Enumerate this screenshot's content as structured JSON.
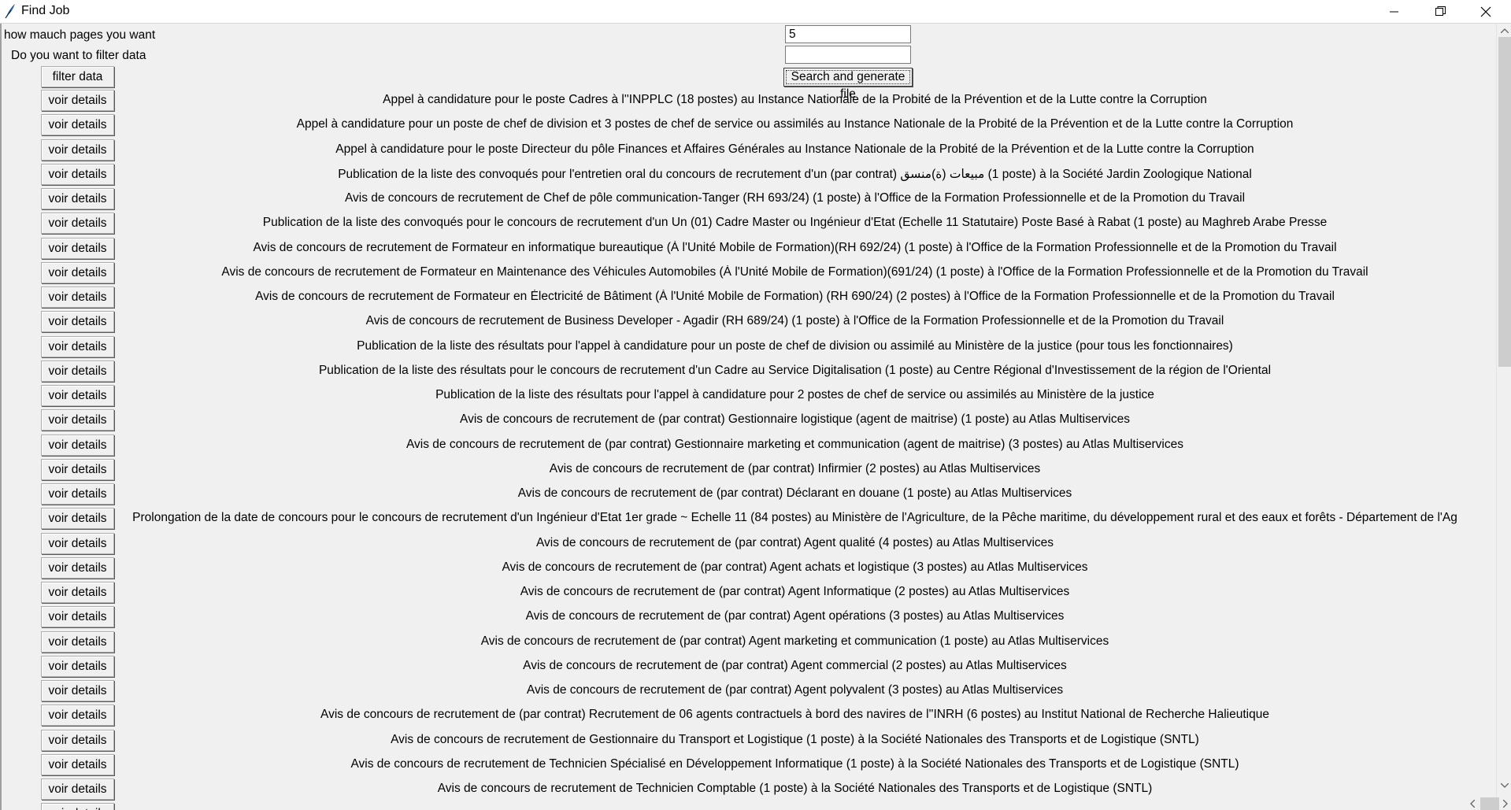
{
  "window": {
    "title": "Find Job",
    "app_icon": "tk-feather-icon",
    "controls": [
      "minimize-icon",
      "restore-icon",
      "close-icon"
    ]
  },
  "form": {
    "pages_label": "how mauch pages you want",
    "pages_value": "5",
    "filter_label": "Do you want to filter data",
    "filter_value": "",
    "filter_button": "filter data",
    "search_button": "Search and generate file"
  },
  "details_label": "voir details",
  "jobs": [
    "Appel à candidature pour le poste Cadres à l''INPPLC (18 postes) au Instance Nationale de la Probité de la Prévention et de la Lutte contre la Corruption",
    "Appel à candidature pour un poste de chef de division et 3 postes de chef de service ou assimilés au Instance Nationale de la Probité de la Prévention et de la Lutte contre la Corruption",
    "Appel à candidature pour le poste Directeur du pôle Finances et Affaires Générales au Instance Nationale de la Probité de la Prévention et de la Lutte contre la Corruption",
    "Publication de la liste des convoqués pour l'entretien oral du concours de recrutement d'un  (par contrat) مبيعات (ة)منسق (1 poste)  à la Société Jardin Zoologique National",
    "Avis de concours de recrutement de Chef de pôle communication-Tanger (RH 693/24) (1 poste)  à l'Office de la Formation Professionnelle et de la Promotion du Travail",
    "Publication de la liste des convoqués pour le concours de recrutement d'un Un (01) Cadre Master ou Ingénieur d'Etat (Echelle 11 Statutaire) Poste Basé à Rabat (1 poste)  au Maghreb Arabe Presse",
    "Avis de concours de recrutement de Formateur en informatique bureautique (À l'Unité Mobile de Formation)(RH 692/24) (1 poste)  à l'Office de la Formation Professionnelle et de la Promotion du Travail",
    "Avis de concours de recrutement de Formateur en Maintenance des Véhicules Automobiles (À l'Unité Mobile de Formation)(691/24) (1 poste)  à l'Office de la Formation Professionnelle et de la Promotion du Travail",
    "Avis de concours de recrutement de Formateur en Électricité de Bâtiment  (À l'Unité Mobile de Formation) (RH 690/24) (2 postes)  à l'Office de la Formation Professionnelle et de la Promotion du Travail",
    "Avis de concours de recrutement de Business Developer - Agadir (RH 689/24) (1 poste)  à l'Office de la Formation Professionnelle et de la Promotion du Travail",
    "Publication de la liste des résultats pour l'appel à candidature pour un poste de chef de division ou assimilé au Ministère de la justice (pour tous les fonctionnaires)",
    "Publication de la liste des résultats pour le concours de recrutement d'un Cadre au Service Digitalisation (1 poste)  au Centre Régional d'Investissement de la région de l'Oriental",
    "Publication de la liste des résultats pour l'appel à candidature pour 2 postes de chef de service ou assimilés au Ministère de la justice",
    "Avis de concours de recrutement de  (par contrat) Gestionnaire logistique (agent de maitrise) (1 poste)  au Atlas Multiservices",
    "Avis de concours de recrutement de  (par contrat) Gestionnaire marketing et communication (agent de maitrise) (3 postes)  au Atlas Multiservices",
    "Avis de concours de recrutement de  (par contrat) Infirmier (2 postes)  au Atlas Multiservices",
    "Avis de concours de recrutement de  (par contrat) Déclarant en douane (1 poste)  au Atlas Multiservices",
    "Prolongation de la date de concours pour le concours de recrutement d'un Ingénieur d'Etat 1er grade ~ Echelle 11 (84 postes)  au Ministère de l'Agriculture, de la Pêche maritime, du développement rural et des eaux et forêts - Département de l'Ag",
    "Avis de concours de recrutement de  (par contrat) Agent qualité (4 postes)  au Atlas Multiservices",
    "Avis de concours de recrutement de  (par contrat) Agent achats et logistique (3 postes)  au Atlas Multiservices",
    "Avis de concours de recrutement de  (par contrat) Agent Informatique (2 postes)  au Atlas Multiservices",
    "Avis de concours de recrutement de  (par contrat) Agent opérations (3 postes)  au Atlas Multiservices",
    "Avis de concours de recrutement de  (par contrat) Agent marketing et communication (1 poste)  au Atlas Multiservices",
    "Avis de concours de recrutement de  (par contrat) Agent commercial (2 postes)  au Atlas Multiservices",
    "Avis de concours de recrutement de  (par contrat) Agent polyvalent (3 postes)  au Atlas Multiservices",
    "Avis de concours de recrutement de  (par contrat) Recrutement de 06 agents contractuels à bord des navires de l''INRH (6 postes)  au Institut National de Recherche Halieutique",
    "Avis de concours de recrutement de Gestionnaire du Transport et Logistique (1 poste)  à la Société Nationales des Transports et de Logistique (SNTL)",
    "Avis de concours de recrutement de Technicien Spécialisé en Développement Informatique (1 poste)  à la Société Nationales des Transports et de Logistique (SNTL)",
    "Avis de concours de recrutement de Technicien Comptable (1 poste)  à la Société Nationales des Transports et de Logistique (SNTL)"
  ],
  "scrollbars": {
    "vertical_icons": [
      "scroll-up-icon",
      "scroll-down-icon"
    ],
    "horizontal_icons": [
      "scroll-left-icon",
      "scroll-right-icon"
    ]
  }
}
